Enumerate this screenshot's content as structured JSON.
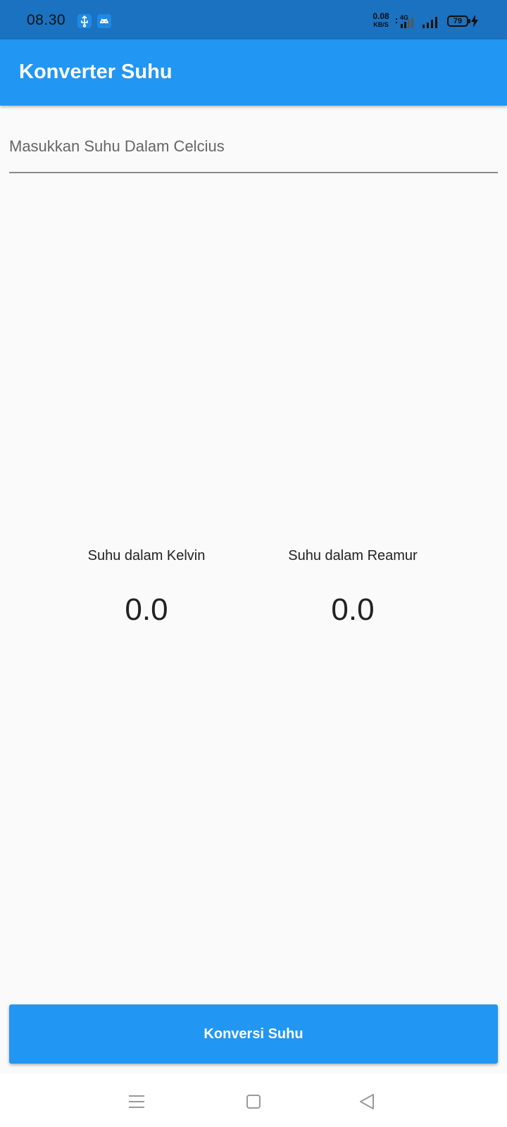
{
  "status_bar": {
    "time": "08.30",
    "net_speed_value": "0.08",
    "net_speed_unit": "KB/S",
    "network_type": "4G",
    "battery_level": "79",
    "background_color": "#1a72c0"
  },
  "app_bar": {
    "title": "Konverter Suhu",
    "color": "#2196f3"
  },
  "input": {
    "placeholder": "Masukkan Suhu Dalam Celcius",
    "value": ""
  },
  "results": {
    "kelvin_label": "Suhu dalam Kelvin",
    "kelvin_value": "0.0",
    "reamur_label": "Suhu dalam Reamur",
    "reamur_value": "0.0"
  },
  "convert_button": {
    "label": "Konversi Suhu"
  },
  "nav_bar": {
    "items": [
      "menu-icon",
      "home-square-icon",
      "back-triangle-icon"
    ]
  }
}
